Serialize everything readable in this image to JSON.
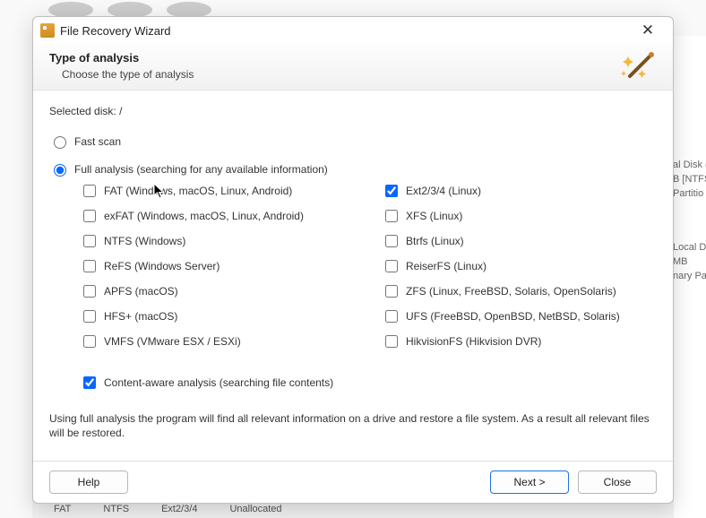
{
  "window": {
    "title": "File Recovery Wizard"
  },
  "header": {
    "title": "Type of analysis",
    "subtitle": "Choose the type of analysis"
  },
  "selected_disk": {
    "label": "Selected disk:",
    "value": "/"
  },
  "scan": {
    "fast_label": "Fast scan",
    "full_label": "Full analysis (searching for any available information)",
    "selected": "full"
  },
  "filesystems_left": [
    {
      "label": "FAT (Windows, macOS, Linux, Android)",
      "checked": false,
      "name": "check-fat"
    },
    {
      "label": "exFAT (Windows, macOS, Linux, Android)",
      "checked": false,
      "name": "check-exfat"
    },
    {
      "label": "NTFS (Windows)",
      "checked": false,
      "name": "check-ntfs"
    },
    {
      "label": "ReFS (Windows Server)",
      "checked": false,
      "name": "check-refs"
    },
    {
      "label": "APFS (macOS)",
      "checked": false,
      "name": "check-apfs"
    },
    {
      "label": "HFS+ (macOS)",
      "checked": false,
      "name": "check-hfsplus"
    },
    {
      "label": "VMFS (VMware ESX / ESXi)",
      "checked": false,
      "name": "check-vmfs"
    }
  ],
  "filesystems_right": [
    {
      "label": "Ext2/3/4 (Linux)",
      "checked": true,
      "name": "check-ext"
    },
    {
      "label": "XFS (Linux)",
      "checked": false,
      "name": "check-xfs"
    },
    {
      "label": "Btrfs (Linux)",
      "checked": false,
      "name": "check-btrfs"
    },
    {
      "label": "ReiserFS (Linux)",
      "checked": false,
      "name": "check-reiserfs"
    },
    {
      "label": "ZFS (Linux, FreeBSD, Solaris, OpenSolaris)",
      "checked": false,
      "name": "check-zfs"
    },
    {
      "label": "UFS (FreeBSD, OpenBSD, NetBSD, Solaris)",
      "checked": false,
      "name": "check-ufs"
    },
    {
      "label": "HikvisionFS (Hikvision DVR)",
      "checked": false,
      "name": "check-hikvisionfs"
    }
  ],
  "content_aware": {
    "label": "Content-aware analysis (searching file contents)",
    "checked": true
  },
  "description": "Using full analysis the program will find all relevant information on a drive and restore a file system. As a result all relevant files will be restored.",
  "buttons": {
    "help": "Help",
    "next": "Next >",
    "close": "Close"
  },
  "background": {
    "panel_items": [
      "al Disk (",
      "B [NTFS",
      "Partitio",
      "",
      "Local D",
      "MB",
      "nary Pa"
    ],
    "status_items": [
      "FAT",
      "NTFS",
      "Ext2/3/4",
      "Unallocated"
    ]
  }
}
